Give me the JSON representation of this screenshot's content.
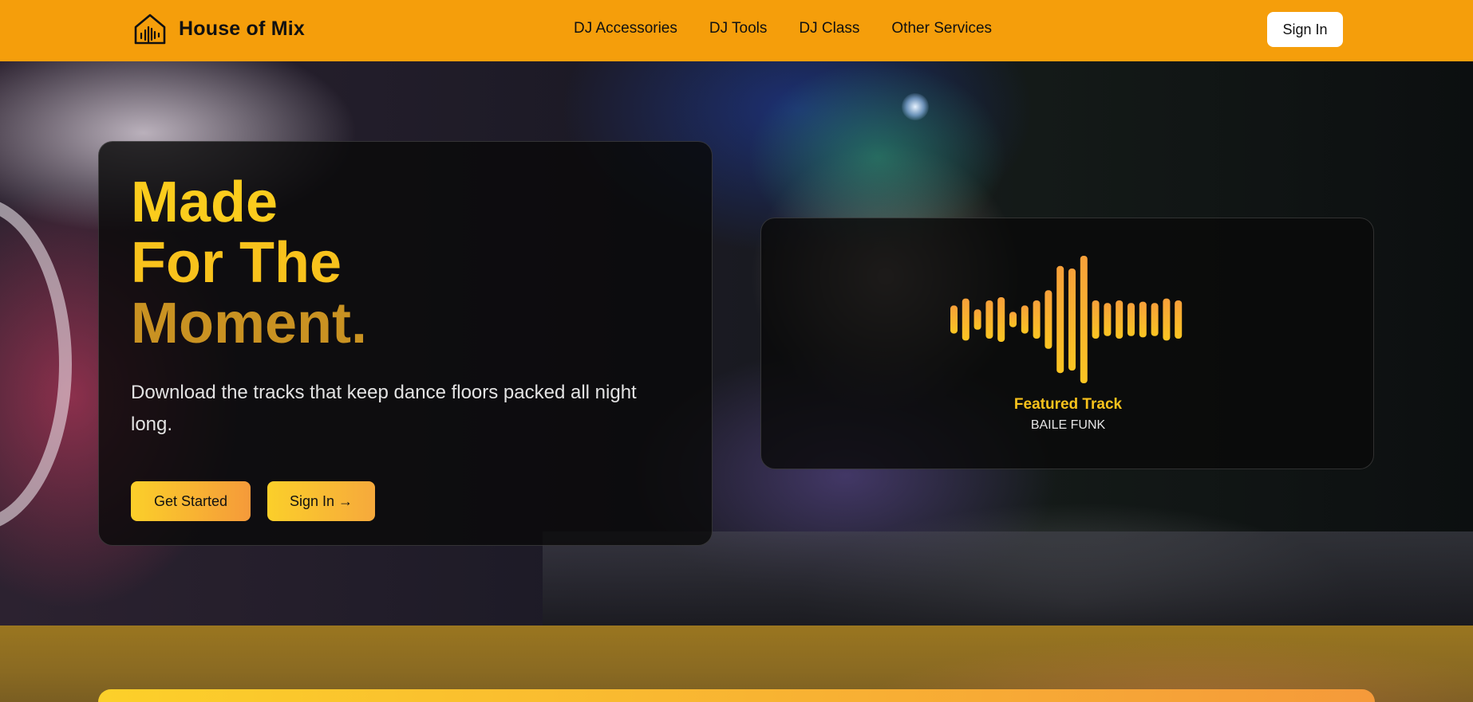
{
  "brand": {
    "name": "House of Mix",
    "logo_icon": "house-waveform-icon"
  },
  "nav": {
    "links": [
      "DJ Accessories",
      "DJ Tools",
      "DJ Class",
      "Other Services"
    ],
    "signin_label": "Sign In"
  },
  "hero": {
    "headline": [
      "Made",
      "For The",
      "Moment."
    ],
    "subtitle": "Download the tracks that keep dance floors packed all night long.",
    "primary_button": "Get Started",
    "secondary_button": "Sign In →"
  },
  "featured": {
    "label": "Featured Track",
    "track": "BAILE FUNK",
    "waveform_levels": [
      0.22,
      0.33,
      0.16,
      0.3,
      0.35,
      0.12,
      0.22,
      0.3,
      0.46,
      0.84,
      0.8,
      1.0,
      0.3,
      0.26,
      0.3,
      0.26,
      0.28,
      0.26,
      0.33,
      0.3
    ]
  },
  "colors": {
    "nav_bg": "#f59e0b",
    "accent_yellow": "#fbcc1d",
    "accent_orange": "#f59a3a"
  }
}
